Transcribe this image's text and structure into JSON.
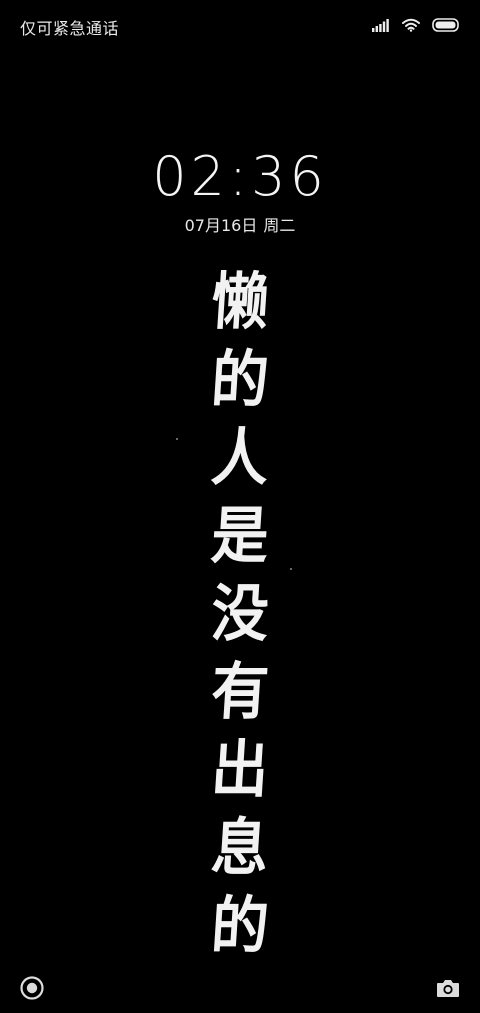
{
  "status_bar": {
    "carrier_text": "仅可紧急通话",
    "icons": [
      "signal-icon",
      "wifi-icon",
      "battery-icon"
    ]
  },
  "lock_screen": {
    "time": "02:36",
    "date": "07月16日",
    "weekday": "周二",
    "wallpaper_characters": [
      "懒",
      "的",
      "人",
      "是",
      "没",
      "有",
      "出",
      "息",
      "的"
    ]
  },
  "bottom_bar": {
    "left_icon": "record-circle-icon",
    "right_icon": "camera-icon"
  },
  "colors": {
    "background": "#000000",
    "text": "#f2f2f2"
  }
}
